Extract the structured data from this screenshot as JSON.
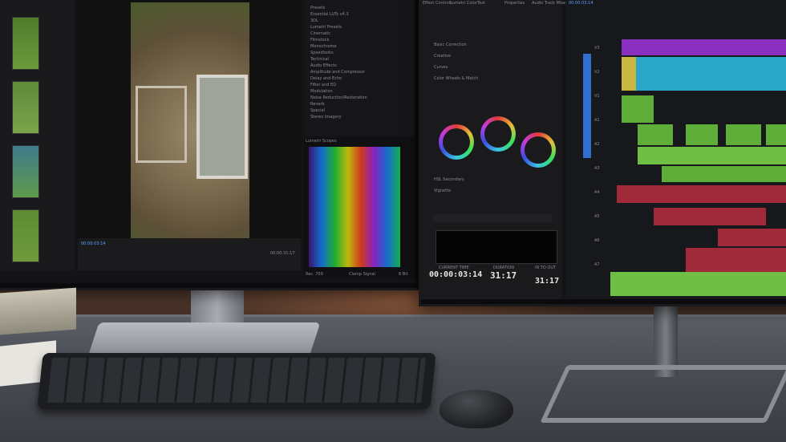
{
  "scene": {
    "description_visible_text": true
  },
  "left_monitor": {
    "effects_items": [
      "Presets",
      "Essential LUTs v4.3",
      "3DL",
      "Lumetri Presets",
      "Cinematic",
      "Filmstock",
      "Monochrome",
      "Speedlooks",
      "Technical",
      "Audio Effects",
      "Amplitude and Compressor",
      "Delay and Echo",
      "Filter and EQ",
      "Modulation",
      "Noise Reduction/Restoration",
      "Reverb",
      "Special",
      "Stereo Imagery"
    ],
    "scope_title": "Lumetri Scopes",
    "viewer_timecode_left": "00:00:03:14",
    "viewer_timecode_right": "00:00:31:17",
    "scope_footer_left": "Rec. 709",
    "scope_footer_right": "Clamp Signal",
    "scope_footer_bits": "8 Bit"
  },
  "right_monitor": {
    "tabs": [
      "Effect Controls",
      "Lumetri Color",
      "Text",
      "Properties",
      "Audio Track Mixer: Audio 1 - THE PROCESS"
    ],
    "sections": [
      "Basic Correction",
      "Creative",
      "Curves",
      "Color Wheels & Match",
      "HSL Secondary",
      "Vignette"
    ],
    "current_time_label": "CURRENT TIME",
    "current_time": "00:00:03:14",
    "duration_label": "DURATION",
    "duration": "31:17",
    "in_to_out_label": "IN TO OUT",
    "in_to_out": "31:17",
    "timeline_timecode": "00:00:03:14",
    "tracks": [
      "V3",
      "V2",
      "V1",
      "A1",
      "A2",
      "A3",
      "A4",
      "A5",
      "A6",
      "A7"
    ]
  },
  "colors": {
    "wall": "#3a2a22",
    "desk": "#4a4d55",
    "screen_bg": "#141416",
    "clip_purple": "#8a2fbf",
    "clip_cyan": "#2aa6c8",
    "clip_green": "#5fae3a",
    "clip_red": "#a02a3a"
  }
}
